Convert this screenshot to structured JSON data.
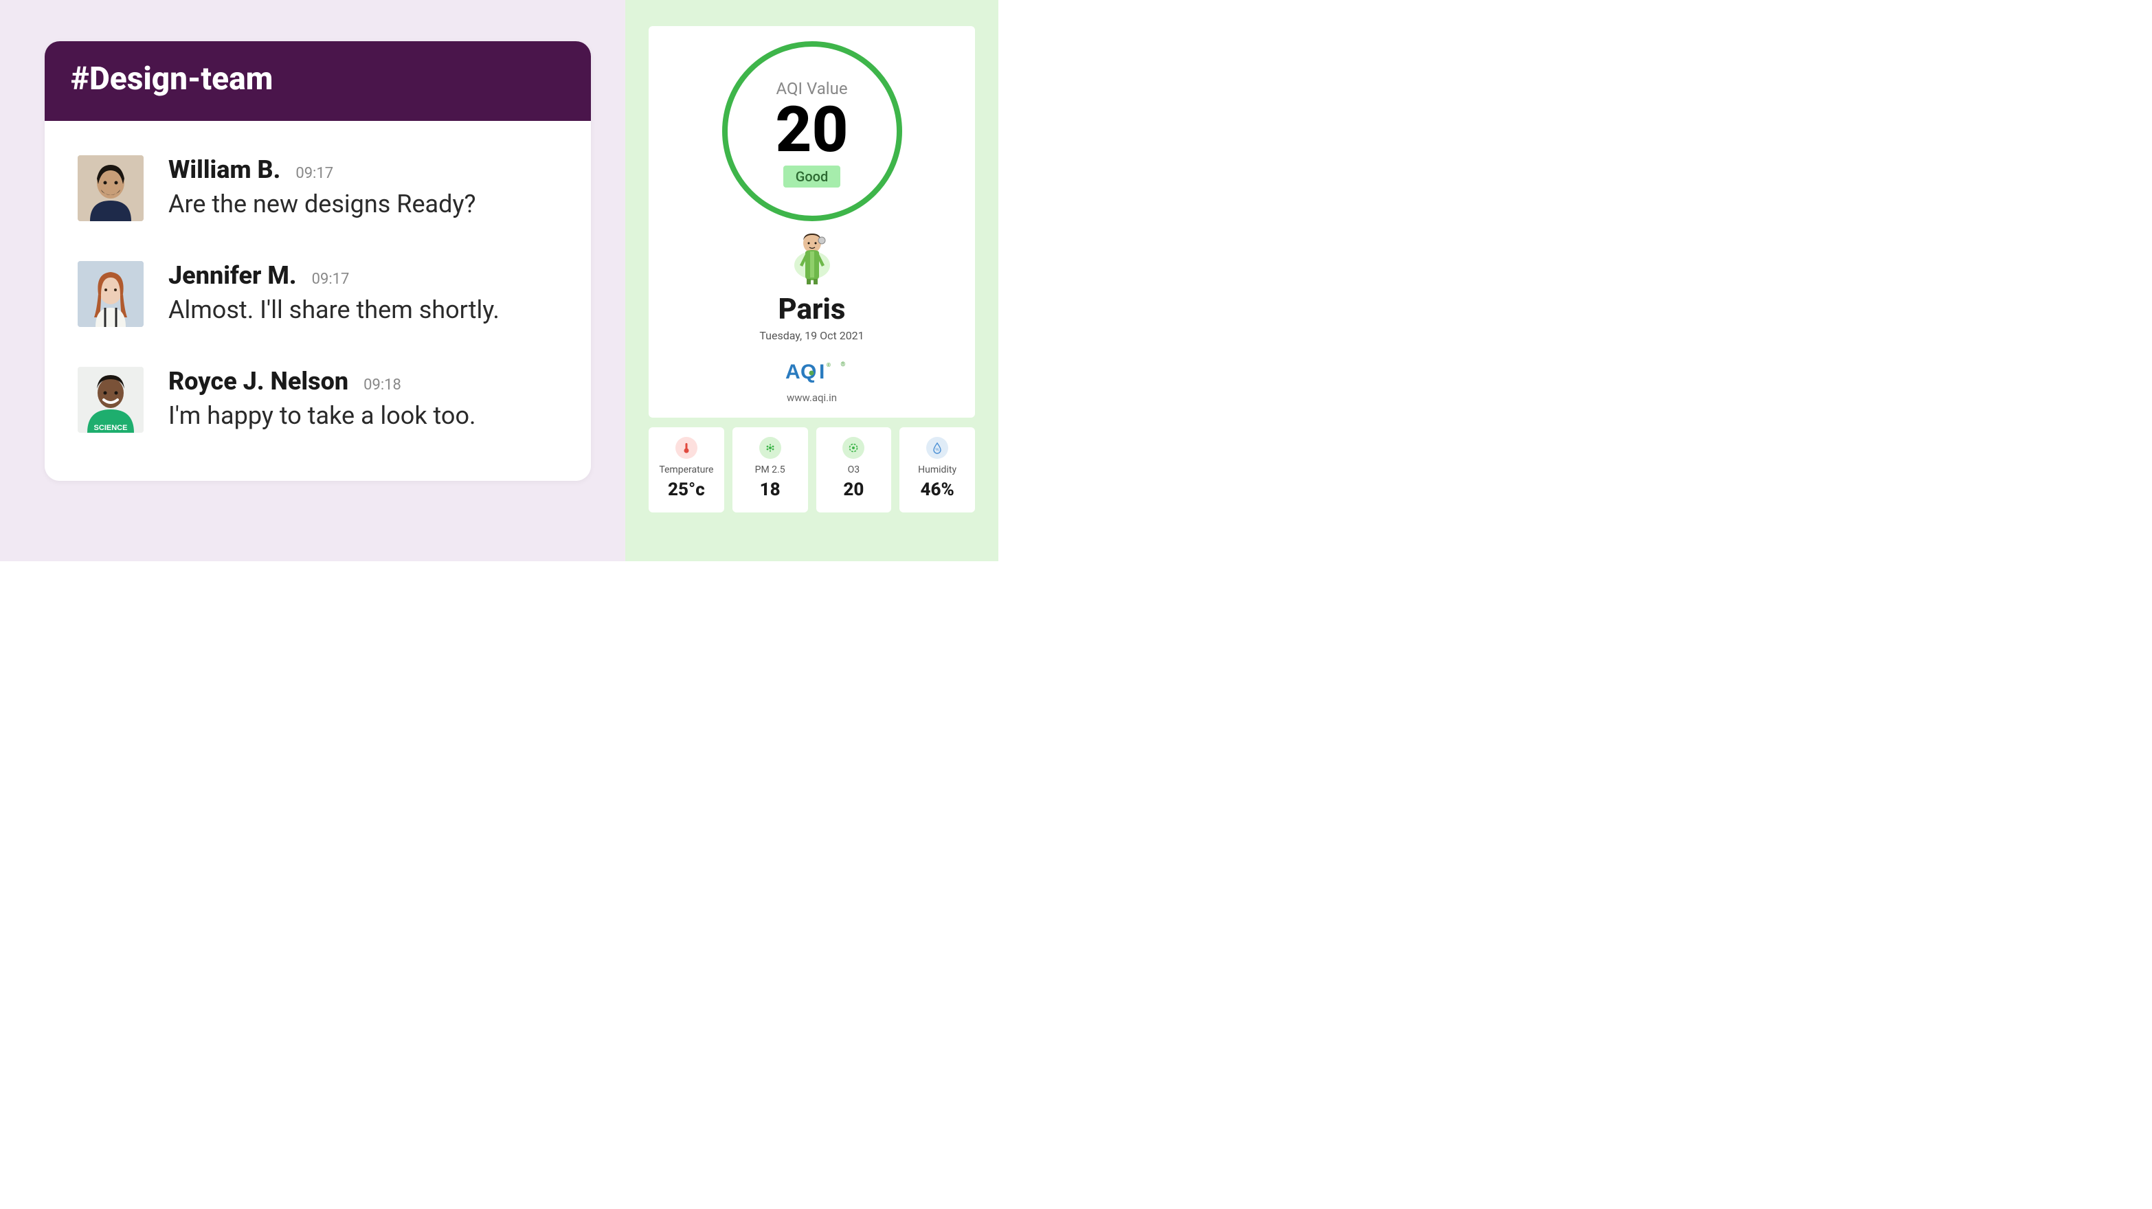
{
  "chat": {
    "channel": "#Design-team",
    "messages": [
      {
        "author": "William B.",
        "time": "09:17",
        "text": "Are the new designs Ready?"
      },
      {
        "author": "Jennifer M.",
        "time": "09:17",
        "text": "Almost. I'll share them shortly."
      },
      {
        "author": "Royce J. Nelson",
        "time": "09:18",
        "text": "I'm happy to take a look too."
      }
    ]
  },
  "aqi": {
    "ring_label": "AQI Value",
    "value": "20",
    "status": "Good",
    "city": "Paris",
    "date": "Tuesday, 19 Oct 2021",
    "brand": "AQI",
    "url": "www.aqi.in",
    "ring_color": "#3eb54a",
    "status_bg": "#a6edac"
  },
  "metrics": [
    {
      "key": "temperature",
      "label": "Temperature",
      "value": "25°c"
    },
    {
      "key": "pm25",
      "label": "PM 2.5",
      "value": "18"
    },
    {
      "key": "o3",
      "label": "O3",
      "value": "20"
    },
    {
      "key": "humidity",
      "label": "Humidity",
      "value": "46%"
    }
  ]
}
